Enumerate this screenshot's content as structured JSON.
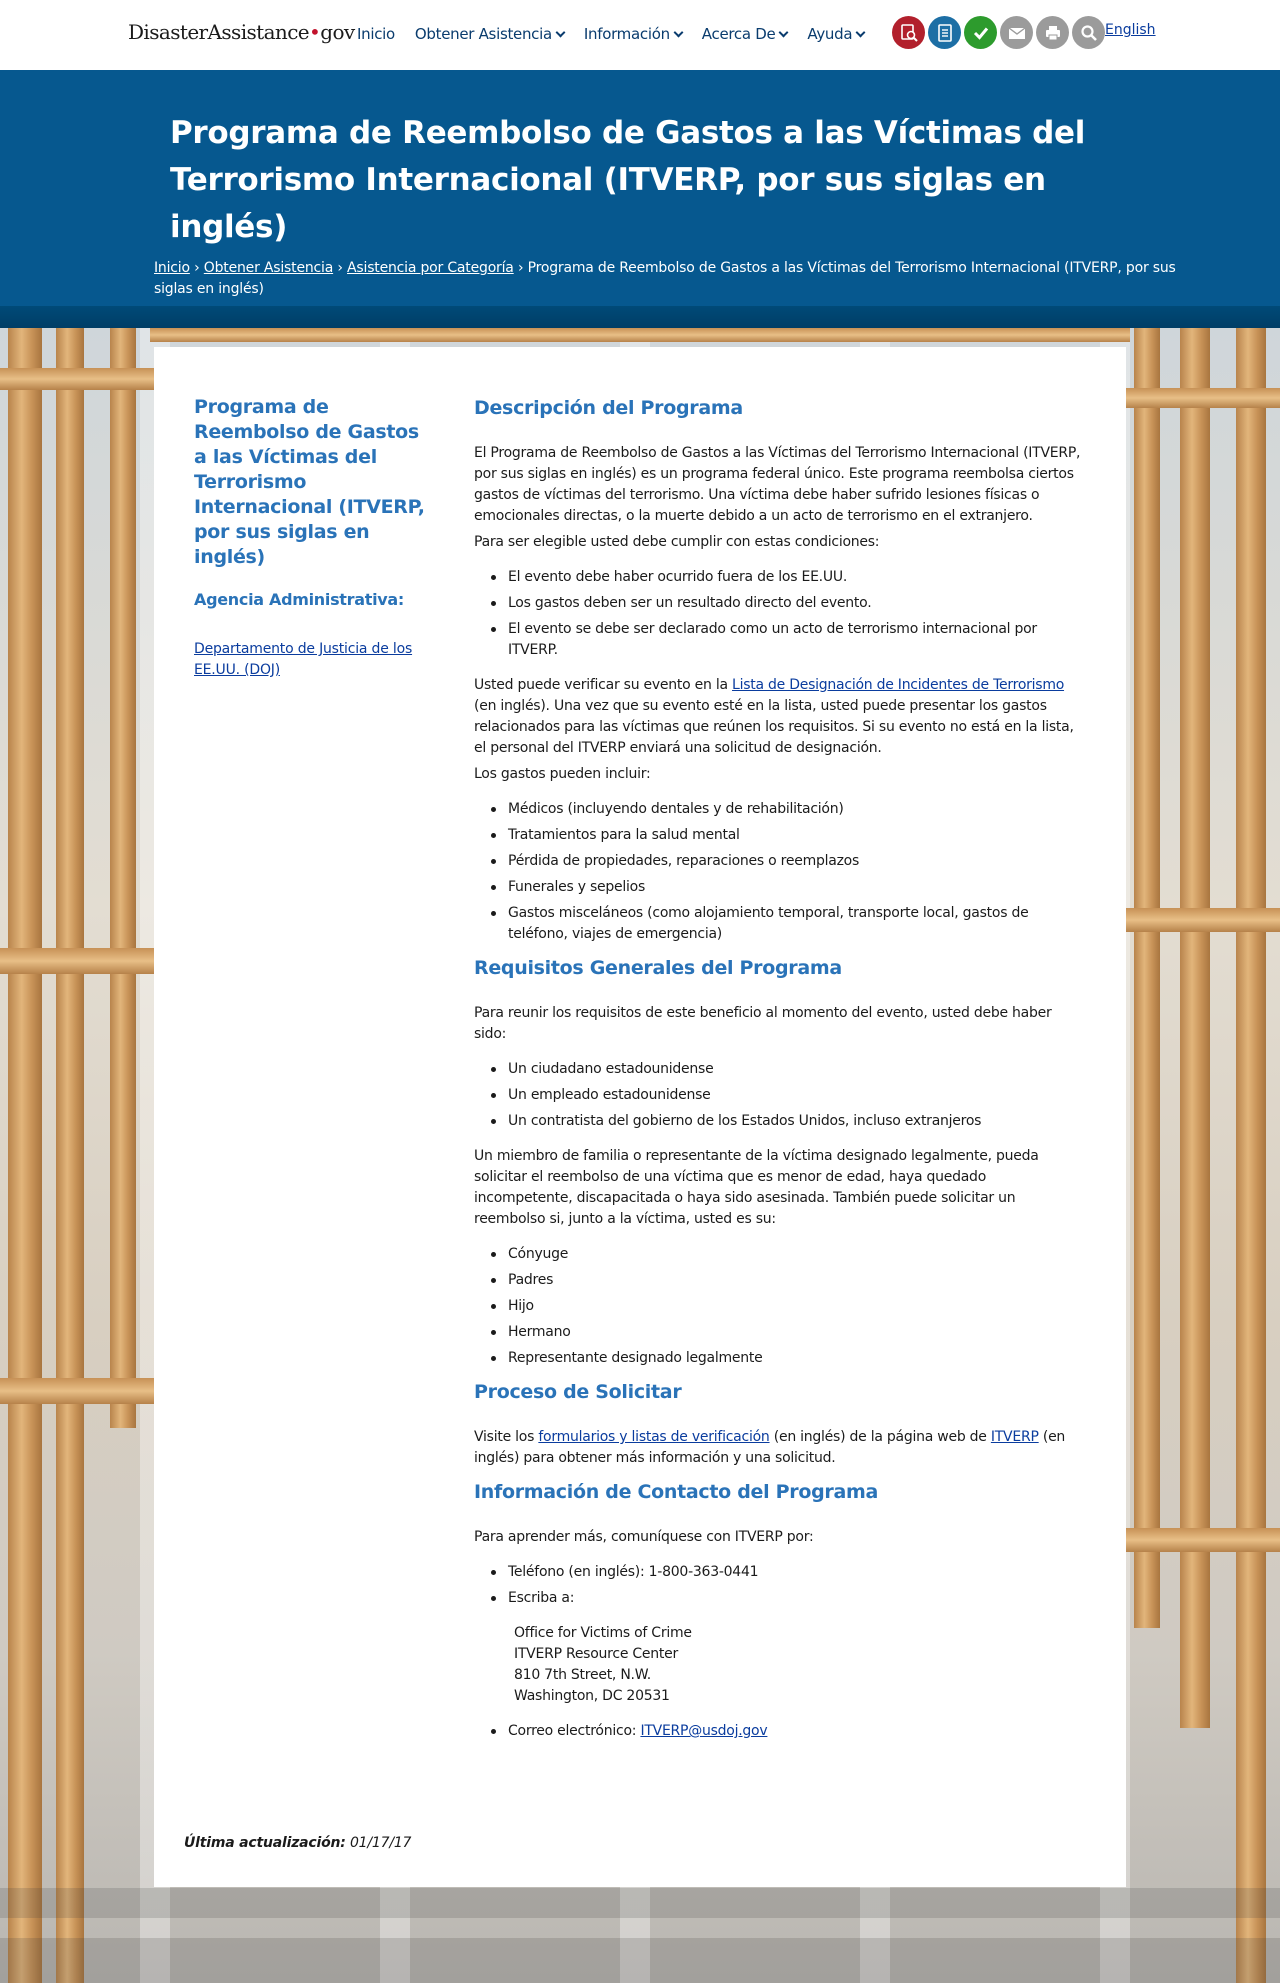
{
  "header": {
    "logo": {
      "part1": "Disaster",
      "part2": "Assistance",
      "dot": "•",
      "tld": "gov"
    },
    "nav": [
      {
        "label": "Inicio",
        "dropdown": false
      },
      {
        "label": "Obtener Asistencia",
        "dropdown": true
      },
      {
        "label": "Información",
        "dropdown": true
      },
      {
        "label": "Acerca De",
        "dropdown": true
      },
      {
        "label": "Ayuda",
        "dropdown": true
      }
    ],
    "tools": [
      {
        "icon": "search-doc-icon",
        "color": "#b2202c"
      },
      {
        "icon": "checklist-icon",
        "color": "#1d6fa5"
      },
      {
        "icon": "checkmark-icon",
        "color": "#2d9b2d"
      },
      {
        "icon": "email-icon",
        "color": "#9b9b9b"
      },
      {
        "icon": "print-icon",
        "color": "#9b9b9b"
      },
      {
        "icon": "search-icon",
        "color": "#9b9b9b"
      }
    ],
    "language_link": "English"
  },
  "banner": {
    "title": "Programa de Reembolso de Gastos a las Víctimas del Terrorismo Internacional (ITVERP, por sus siglas en inglés)",
    "breadcrumb": {
      "links": [
        "Inicio",
        "Obtener Asistencia",
        "Asistencia por Categoría"
      ],
      "separator": "›",
      "current": "Programa de Reembolso de Gastos a las Víctimas del Terrorismo Internacional (ITVERP, por sus siglas en inglés)"
    }
  },
  "sidebar": {
    "title": "Programa de Reembolso de Gastos a las Víctimas del Terrorismo Internacional (ITVERP, por sus siglas en inglés)",
    "agency_label": "Agencia Administrativa:",
    "agency_link": "Departamento de Justicia de los EE.UU. (DOJ)"
  },
  "content": {
    "description": {
      "heading": "Descripción del Programa",
      "intro": "El Programa de Reembolso de Gastos a las Víctimas del Terrorismo Internacional (ITVERP, por sus siglas en inglés) es un programa federal único. Este programa reembolsa ciertos gastos de víctimas del terrorismo. Una víctima debe haber sufrido lesiones físicas o emocionales directas, o la muerte debido a un acto de terrorismo en el extranjero.",
      "eligibility_intro": "Para ser elegible usted debe cumplir con estas condiciones:",
      "conditions": [
        "El evento debe haber ocurrido fuera de los EE.UU.",
        "Los gastos deben ser un resultado directo del evento.",
        "El evento se debe ser declarado como un acto de terrorismo internacional por ITVERP."
      ],
      "verify_before": "Usted puede verificar su evento en la ",
      "verify_link": "Lista de Designación de Incidentes de Terrorismo",
      "verify_after": " (en inglés). Una vez que su evento esté en la lista, usted puede presentar los gastos relacionados para las víctimas que reúnen los requisitos. Si su evento no está en la lista, el personal del ITVERP enviará una solicitud de designación.",
      "expenses_intro": "Los gastos pueden incluir:",
      "expenses": [
        "Médicos (incluyendo dentales y de rehabilitación)",
        "Tratamientos para la salud mental",
        "Pérdida de propiedades, reparaciones o reemplazos",
        "Funerales y sepelios",
        "Gastos misceláneos (como alojamiento temporal, transporte local, gastos de teléfono, viajes de emergencia)"
      ]
    },
    "requirements": {
      "heading": "Requisitos Generales del Programa",
      "intro": "Para reunir los requisitos de este beneficio al momento del evento, usted debe haber sido:",
      "items": [
        "Un ciudadano estadounidense",
        "Un empleado estadounidense",
        "Un contratista del gobierno de los Estados Unidos, incluso extranjeros"
      ],
      "family_text": "Un miembro de familia o representante de la víctima designado legalmente, pueda solicitar el reembolso de una víctima que es menor de edad, haya quedado incompetente, discapacitada o haya sido asesinada. También puede solicitar un reembolso si, junto a la víctima, usted es su:",
      "relations": [
        "Cónyuge",
        "Padres",
        "Hijo",
        "Hermano",
        "Representante designado legalmente"
      ]
    },
    "application": {
      "heading": "Proceso de Solicitar",
      "text_before": "Visite los ",
      "link1": "formularios y listas de verificación",
      "text_middle": " (en inglés) de la página web de ",
      "link2": "ITVERP",
      "text_after": " (en inglés) para obtener más información y una solicitud."
    },
    "contact": {
      "heading": "Información de Contacto del Programa",
      "intro": "Para aprender más, comuníquese con ITVERP por:",
      "phone": "Teléfono (en inglés): 1-800-363-0441",
      "write_label": "Escriba a:",
      "address": [
        "Office for Victims of Crime",
        "ITVERP Resource Center",
        "810 7th Street, N.W.",
        "Washington, DC 20531"
      ],
      "email_label": "Correo electrónico: ",
      "email": "ITVERP@usdoj.gov"
    }
  },
  "footer": {
    "updated_label": "Última actualización:",
    "updated_date": "01/17/17"
  },
  "colors": {
    "banner": "#06588f",
    "heading": "#2a73b8",
    "link": "#0a3c9e",
    "nav_text": "#0a3c6e"
  }
}
